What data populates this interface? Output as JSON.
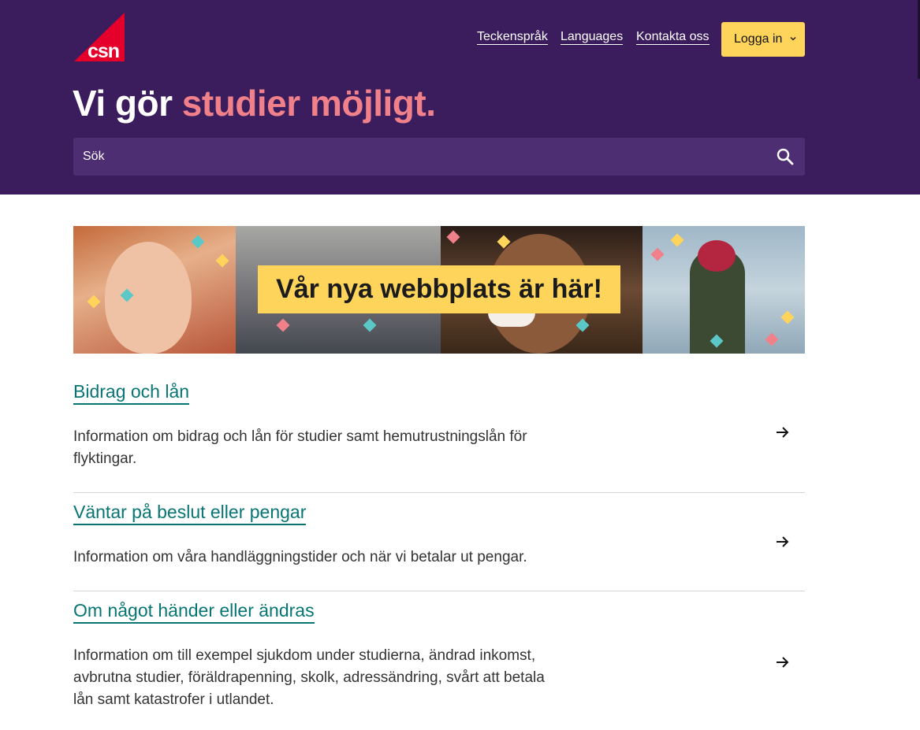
{
  "header": {
    "logo_text": "csn",
    "nav_links": [
      "Teckenspråk",
      "Languages",
      "Kontakta oss"
    ],
    "login_label": "Logga in"
  },
  "hero": {
    "headline_white": "Vi gör ",
    "headline_pink": "studier möjligt."
  },
  "search": {
    "placeholder": "Sök",
    "value": ""
  },
  "banner": {
    "label": "Vår nya webbplats är här!"
  },
  "items": [
    {
      "title": "Bidrag och lån",
      "description": "Information om bidrag och lån för studier samt hemutrustningslån för flyktingar."
    },
    {
      "title": "Väntar på beslut eller pengar",
      "description": "Information om våra handläggningstider och när vi betalar ut pengar."
    },
    {
      "title": "Om något händer eller ändras",
      "description": "Information om till exempel sjukdom under studierna, ändrad inkomst, avbrutna studier, föräldrapenning, skolk, adressändring, svårt att betala lån samt katastrofer i utlandet."
    }
  ],
  "colors": {
    "hero_bg": "#3b1d5e",
    "search_bg": "#4e2e73",
    "accent_pink": "#f0818a",
    "login_bg": "#ffd45a",
    "link_teal": "#077573",
    "logo_red": "#e4002b"
  },
  "icons": {
    "search": "search-icon",
    "login_chevron": "chevron-down-icon",
    "item_arrow": "arrow-right-icon"
  }
}
